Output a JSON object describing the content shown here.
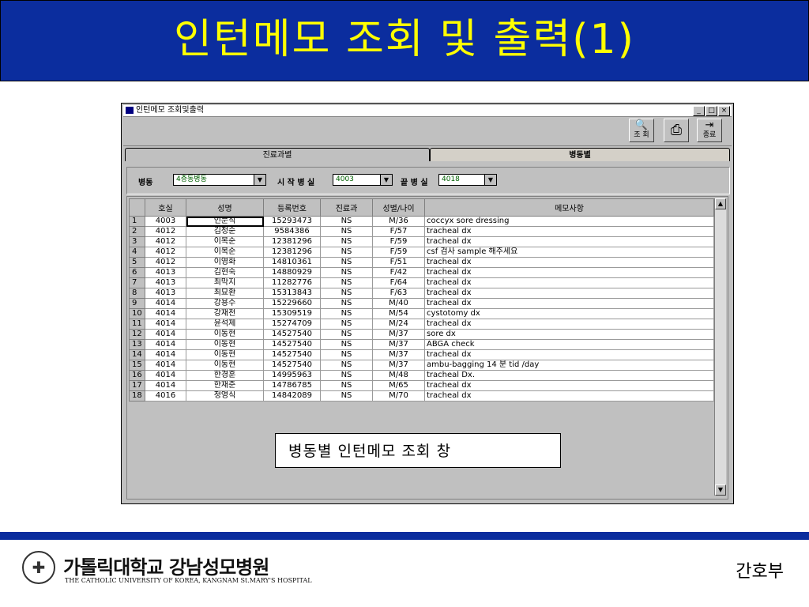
{
  "slide": {
    "title": "인턴메모 조회 및 출력(1)",
    "caption": "병동별 인턴메모 조회 창",
    "department": "간호부",
    "logo_korean": "가톨릭대학교 강남성모병원",
    "logo_english": "THE CATHOLIC UNIVERSITY OF KOREA, KANGNAM St.MARY'S HOSPITAL",
    "colors": {
      "banner": "#0b2d9e",
      "title_text": "#ffff00"
    }
  },
  "window": {
    "title": "인턴메모 조회및출력",
    "controls": {
      "minimize": "_",
      "maximize": "□",
      "close": "×"
    },
    "toolbar": {
      "query_label": "조 회",
      "exit_label": "종료",
      "icons": {
        "query": "magnifier-document-icon",
        "print": "printer-icon",
        "exit": "exit-door-icon"
      }
    },
    "tabs": [
      {
        "label": "진료과별",
        "active": false
      },
      {
        "label": "병동별",
        "active": true
      }
    ],
    "filters": {
      "ward_label": "병동",
      "ward_value": "4층동병동",
      "start_room_label": "시 작 병 실",
      "start_room_value": "4003",
      "end_room_label": "끝 병 실",
      "end_room_value": "4018"
    },
    "grid": {
      "headers": [
        "",
        "호실",
        "성명",
        "등록번호",
        "진료과",
        "성별/나이",
        "메모사항"
      ],
      "rows": [
        {
          "n": "1",
          "room": "4003",
          "name": "인문식",
          "reg": "15293473",
          "dept": "NS",
          "sexage": "M/36",
          "memo": "coccyx sore dressing"
        },
        {
          "n": "2",
          "room": "4012",
          "name": "김정순",
          "reg": "9584386",
          "dept": "NS",
          "sexage": "F/57",
          "memo": "tracheal dx"
        },
        {
          "n": "3",
          "room": "4012",
          "name": "이복순",
          "reg": "12381296",
          "dept": "NS",
          "sexage": "F/59",
          "memo": "tracheal dx"
        },
        {
          "n": "4",
          "room": "4012",
          "name": "이복순",
          "reg": "12381296",
          "dept": "NS",
          "sexage": "F/59",
          "memo": "csf 검사 sample 해주세요"
        },
        {
          "n": "5",
          "room": "4012",
          "name": "이영화",
          "reg": "14810361",
          "dept": "NS",
          "sexage": "F/51",
          "memo": "tracheal dx"
        },
        {
          "n": "6",
          "room": "4013",
          "name": "김현숙",
          "reg": "14880929",
          "dept": "NS",
          "sexage": "F/42",
          "memo": "tracheal dx"
        },
        {
          "n": "7",
          "room": "4013",
          "name": "최막지",
          "reg": "11282776",
          "dept": "NS",
          "sexage": "F/64",
          "memo": "tracheal dx"
        },
        {
          "n": "8",
          "room": "4013",
          "name": "최묘환",
          "reg": "15313843",
          "dept": "NS",
          "sexage": "F/63",
          "memo": "tracheal dx"
        },
        {
          "n": "9",
          "room": "4014",
          "name": "강용수",
          "reg": "15229660",
          "dept": "NS",
          "sexage": "M/40",
          "memo": "tracheal dx"
        },
        {
          "n": "10",
          "room": "4014",
          "name": "강재천",
          "reg": "15309519",
          "dept": "NS",
          "sexage": "M/54",
          "memo": "cystotomy dx"
        },
        {
          "n": "11",
          "room": "4014",
          "name": "윤석제",
          "reg": "15274709",
          "dept": "NS",
          "sexage": "M/24",
          "memo": "tracheal dx"
        },
        {
          "n": "12",
          "room": "4014",
          "name": "이동현",
          "reg": "14527540",
          "dept": "NS",
          "sexage": "M/37",
          "memo": "sore dx"
        },
        {
          "n": "13",
          "room": "4014",
          "name": "이동현",
          "reg": "14527540",
          "dept": "NS",
          "sexage": "M/37",
          "memo": "ABGA check"
        },
        {
          "n": "14",
          "room": "4014",
          "name": "이동현",
          "reg": "14527540",
          "dept": "NS",
          "sexage": "M/37",
          "memo": "tracheal dx"
        },
        {
          "n": "15",
          "room": "4014",
          "name": "이동현",
          "reg": "14527540",
          "dept": "NS",
          "sexage": "M/37",
          "memo": "ambu-bagging 14 분 tid /day"
        },
        {
          "n": "16",
          "room": "4014",
          "name": "한경훈",
          "reg": "14995963",
          "dept": "NS",
          "sexage": "M/48",
          "memo": "tracheal Dx."
        },
        {
          "n": "17",
          "room": "4014",
          "name": "한재준",
          "reg": "14786785",
          "dept": "NS",
          "sexage": "M/65",
          "memo": "tracheal dx"
        },
        {
          "n": "18",
          "room": "4016",
          "name": "정영식",
          "reg": "14842089",
          "dept": "NS",
          "sexage": "M/70",
          "memo": "tracheal dx"
        }
      ]
    },
    "scroll": {
      "up": "▲",
      "down": "▼"
    }
  }
}
